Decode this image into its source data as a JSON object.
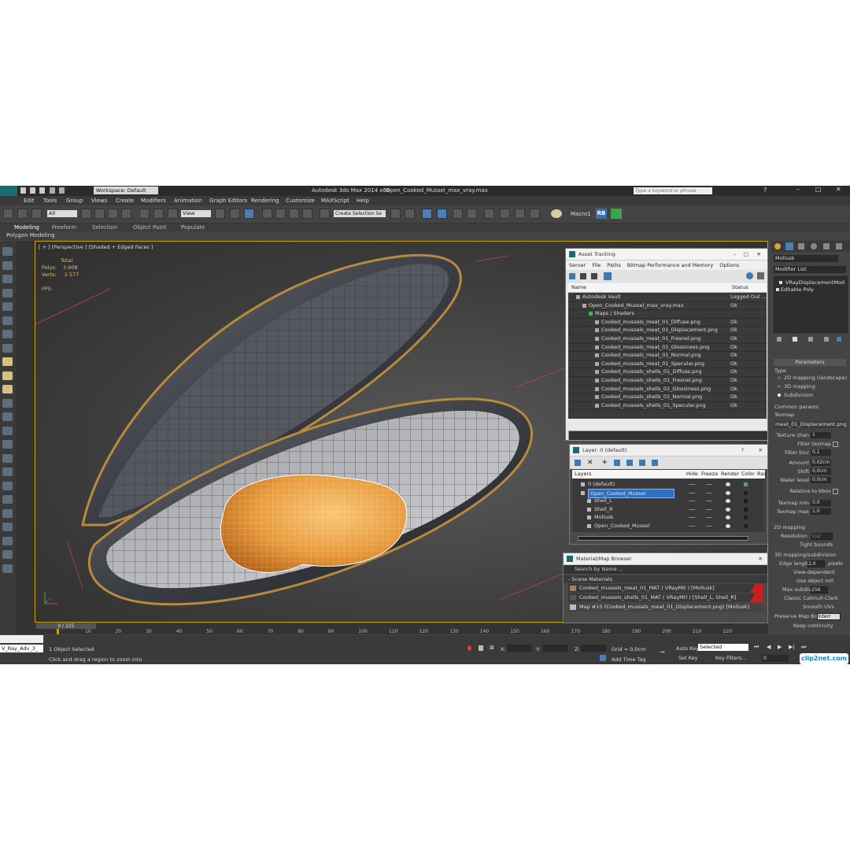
{
  "window": {
    "app_title": "Autodesk 3ds Max  2014 x64",
    "file_title": "Open_Cooked_Mussel_max_vray.max",
    "workspace": "Workspace: Default",
    "search_placeholder": "Type a keyword or phrase"
  },
  "menu": [
    "Edit",
    "Tools",
    "Group",
    "Views",
    "Create",
    "Modifiers",
    "Animation",
    "Graph Editors",
    "Rendering",
    "Customize",
    "MAXScript",
    "Help"
  ],
  "toolbar": {
    "filter_value": "All",
    "view_value": "View",
    "selection_set": "Create Selection Se",
    "macro_label": "Macro1",
    "rb_label": "RB"
  },
  "ribbon": {
    "tabs": [
      "Modeling",
      "Freeform",
      "Selection",
      "Object Paint",
      "Populate"
    ],
    "sub": "Polygon Modeling"
  },
  "viewport": {
    "label": "[ + ] [Perspective ] [Shaded + Edged Faces ]",
    "total_label": "Total",
    "polys_label": "Polys:",
    "polys_value": "3 908",
    "verts_label": "Verts:",
    "verts_value": "2 577",
    "fps_label": "FPS:"
  },
  "asset_tracking": {
    "title": "Asset Tracking",
    "menu": [
      "Server",
      "File",
      "Paths",
      "Bitmap Performance and Memory",
      "Options"
    ],
    "col_name": "Name",
    "col_status": "Status",
    "rows": [
      {
        "name": "Autodesk Vault",
        "status": "Logged Out ...",
        "indent": 1
      },
      {
        "name": "Open_Cooked_Mussel_max_vray.max",
        "status": "Ok",
        "indent": 2
      },
      {
        "name": "Maps / Shaders",
        "status": "",
        "indent": 3
      },
      {
        "name": "Cooked_mussels_meat_01_Diffuse.png",
        "status": "Ok",
        "indent": 4
      },
      {
        "name": "Cooked_mussels_meat_01_Displacement.png",
        "status": "Ok",
        "indent": 4
      },
      {
        "name": "Cooked_mussels_meat_01_Fresnel.png",
        "status": "Ok",
        "indent": 4
      },
      {
        "name": "Cooked_mussels_meat_01_Glossiness.png",
        "status": "Ok",
        "indent": 4
      },
      {
        "name": "Cooked_mussels_meat_01_Normal.png",
        "status": "Ok",
        "indent": 4
      },
      {
        "name": "Cooked_mussels_meat_01_Specular.png",
        "status": "Ok",
        "indent": 4
      },
      {
        "name": "Cooked_mussels_shells_01_Diffuse.png",
        "status": "Ok",
        "indent": 4
      },
      {
        "name": "Cooked_mussels_shells_01_Fresnel.png",
        "status": "Ok",
        "indent": 4
      },
      {
        "name": "Cooked_mussels_shells_01_Glossiness.png",
        "status": "Ok",
        "indent": 4
      },
      {
        "name": "Cooked_mussels_shells_01_Normal.png",
        "status": "Ok",
        "indent": 4
      },
      {
        "name": "Cooked_mussels_shells_01_Specular.png",
        "status": "Ok",
        "indent": 4
      }
    ]
  },
  "layer": {
    "title": "Layer: 0 (default)",
    "col_layers": "Layers",
    "col_hide": "Hide",
    "col_freeze": "Freeze",
    "col_render": "Render",
    "col_color": "Color",
    "col_rad": "Rac",
    "rows": [
      {
        "name": "0 (default)",
        "indent": 1,
        "color": "#3cb54a"
      },
      {
        "name": "Open_Cooked_Mussel",
        "indent": 1,
        "color": "#1f1f1f",
        "selected": true
      },
      {
        "name": "Shell_L",
        "indent": 2,
        "color": "#1f1f1f"
      },
      {
        "name": "Shell_R",
        "indent": 2,
        "color": "#1f1f1f"
      },
      {
        "name": "Mollusk",
        "indent": 2,
        "color": "#1f1f1f"
      },
      {
        "name": "Open_Cooked_Mussel",
        "indent": 2,
        "color": "#1f1f1f"
      }
    ]
  },
  "material_browser": {
    "title": "Material/Map Browser",
    "search_placeholder": "Search by Name ...",
    "section": "- Scene Materials",
    "items": [
      "Cooked_mussels_meat_01_MAT  ( VRayMtl ) [Mollusk]",
      "Cooked_mussels_shells_01_MAT  ( VRayMtl ) [Shell_L, Shell_R]",
      "Map #15 (Cooked_mussels_meat_01_Displacement.png) [Mollusk]"
    ]
  },
  "modifier_panel": {
    "object_name": "Mollusk",
    "modifier_list": "Modifier List",
    "stack": [
      "VRayDisplacementMod",
      "Editable Poly"
    ],
    "parameters": "Parameters",
    "type_label": "Type",
    "type_options": [
      "2D mapping (landscape)",
      "3D mapping",
      "Subdivision"
    ],
    "common_params": "Common params",
    "texmap": "Texmap",
    "texmap_value": "meat_01_Displacement.png)",
    "fields": [
      {
        "label": "Texture chan",
        "value": "1"
      },
      {
        "label": "Filter texmap",
        "value": ""
      },
      {
        "label": "Filter blur",
        "value": "0,1"
      },
      {
        "label": "Amount",
        "value": "0,02cm"
      },
      {
        "label": "Shift",
        "value": "0,0cm"
      },
      {
        "label": "Water level",
        "value": "0,0cm"
      },
      {
        "label": "Relative to bbox",
        "value": ""
      },
      {
        "label": "Texmap min",
        "value": "0,0"
      },
      {
        "label": "Texmap max",
        "value": "1,0"
      }
    ],
    "mapping_2d": "2D mapping",
    "resolution_label": "Resolution",
    "resolution_value": "512",
    "tight_bounds": "Tight bounds",
    "mapping_3d": "3D mapping/subdivision",
    "edge_length_label": "Edge length",
    "edge_length_value": "2,0",
    "pixels_label": "pixels",
    "view_dependent": "View-dependent",
    "use_object_mtl": "Use object mtl",
    "max_subdivs_label": "Max subdivs",
    "max_subdivs_value": "256",
    "catmull": "Classic Catmull-Clark",
    "smooth_uvs": "Smooth UVs",
    "preserve_label": "Preserve Map Bnd",
    "preserve_value": "Interr",
    "keep_continuity": "Keep continuity"
  },
  "timeline": {
    "frame": "0 / 225",
    "ticks": [
      "10",
      "20",
      "30",
      "40",
      "50",
      "60",
      "70",
      "80",
      "90",
      "100",
      "110",
      "120",
      "130",
      "140",
      "150",
      "160",
      "170",
      "180",
      "190",
      "200",
      "210",
      "220"
    ]
  },
  "status": {
    "script_label": "V_Ray_Adv_3_",
    "selected": "1 Object Selected",
    "prompt": "Click and drag a region to zoom into",
    "x_label": "X:",
    "y_label": "Y:",
    "z_label": "Z:",
    "grid": "Grid = 0,0cm",
    "auto_key": "Auto Key",
    "selected_dropdown": "Selected",
    "set_key": "Set Key",
    "key_filters": "Key Filters...",
    "add_time_tag": "Add Time Tag",
    "frame_value": "0"
  },
  "watermark": "clip2net.com",
  "colors": {
    "accent": "#4a7fb5",
    "viewport_border": "#c9a100",
    "mussel_meat": "#e89a3c",
    "shell": "#2a2d33"
  }
}
